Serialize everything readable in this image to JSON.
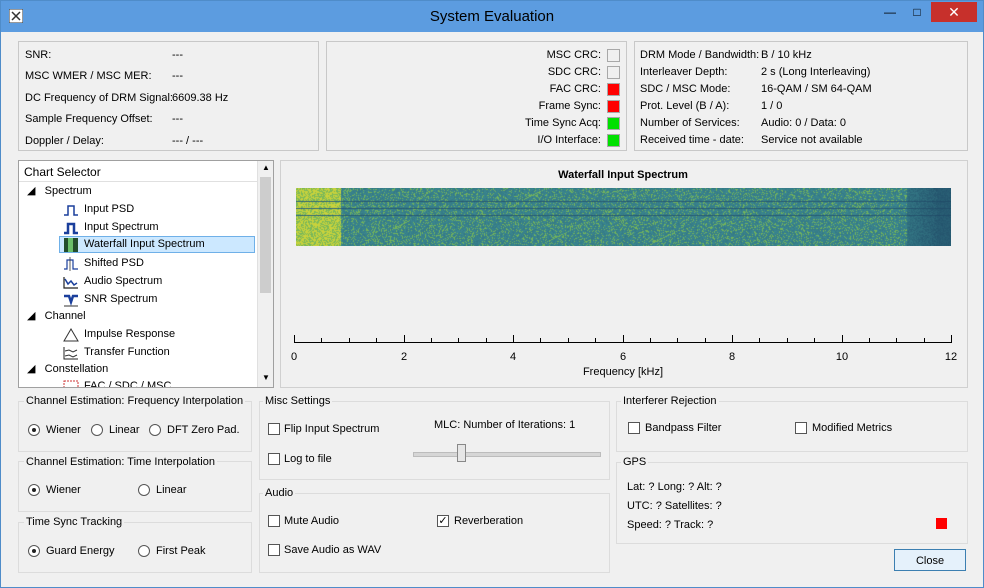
{
  "window": {
    "title": "System Evaluation",
    "min": "—",
    "max": "□",
    "close": "✕"
  },
  "status": {
    "labels": [
      "SNR:",
      "MSC WMER / MSC MER:",
      "DC Frequency of DRM Signal:",
      "Sample Frequency Offset:",
      "Doppler / Delay:"
    ],
    "values": [
      "---",
      "---",
      "6609.38 Hz",
      "---",
      "--- / ---"
    ]
  },
  "crc": {
    "items": [
      {
        "label": "MSC CRC:",
        "color": "#f0f0f0"
      },
      {
        "label": "SDC CRC:",
        "color": "#f0f0f0"
      },
      {
        "label": "FAC CRC:",
        "color": "#ff0000"
      },
      {
        "label": "Frame Sync:",
        "color": "#ff0000"
      },
      {
        "label": "Time Sync Acq:",
        "color": "#00e000"
      },
      {
        "label": "I/O Interface:",
        "color": "#00e000"
      }
    ]
  },
  "drm": {
    "labels": [
      "DRM Mode / Bandwidth:",
      "Interleaver Depth:",
      "SDC / MSC Mode:",
      "Prot. Level (B / A):",
      "Number of Services:",
      "Received time - date:"
    ],
    "values": [
      "B / 10 kHz",
      "2 s (Long Interleaving)",
      "16-QAM / SM 64-QAM",
      "1 / 0",
      "Audio: 0 / Data: 0",
      "Service not available"
    ]
  },
  "chart_selector": {
    "header": "Chart Selector",
    "groups": [
      "Spectrum",
      "Channel",
      "Constellation"
    ],
    "items": [
      "Input PSD",
      "Input Spectrum",
      "Waterfall Input Spectrum",
      "Shifted PSD",
      "Audio Spectrum",
      "SNR Spectrum",
      "Impulse Response",
      "Transfer Function",
      "FAC / SDC / MSC"
    ],
    "selected": "Waterfall Input Spectrum"
  },
  "chart_data": {
    "type": "heatmap",
    "title": "Waterfall Input Spectrum",
    "xlabel": "Frequency [kHz]",
    "xlim": [
      0,
      12
    ],
    "x_ticks": [
      "0",
      "2",
      "4",
      "6",
      "8",
      "10",
      "12"
    ]
  },
  "freq_interp": {
    "title": "Channel Estimation: Frequency Interpolation",
    "options": [
      "Wiener",
      "Linear",
      "DFT Zero Pad."
    ],
    "selected": "Wiener"
  },
  "time_interp": {
    "title": "Channel Estimation: Time Interpolation",
    "options": [
      "Wiener",
      "Linear"
    ],
    "selected": "Wiener"
  },
  "time_sync": {
    "title": "Time Sync Tracking",
    "options": [
      "Guard Energy",
      "First Peak"
    ],
    "selected": "Guard Energy"
  },
  "misc": {
    "title": "Misc Settings",
    "flip": "Flip Input Spectrum",
    "log": "Log to file",
    "mlc_label": "MLC: Number of Iterations: 1"
  },
  "audio": {
    "title": "Audio",
    "mute": "Mute Audio",
    "reverb": "Reverberation",
    "save_wav": "Save Audio as WAV",
    "reverb_checked": true
  },
  "interferer": {
    "title": "Interferer Rejection",
    "bandpass": "Bandpass Filter",
    "modified": "Modified Metrics"
  },
  "gps": {
    "title": "GPS",
    "line1": "Lat: ?  Long: ?  Alt: ?",
    "line2": "UTC: ?  Satellites: ?",
    "line3": "Speed: ?  Track: ?",
    "indicator_color": "#ff0000"
  },
  "close_label": "Close"
}
